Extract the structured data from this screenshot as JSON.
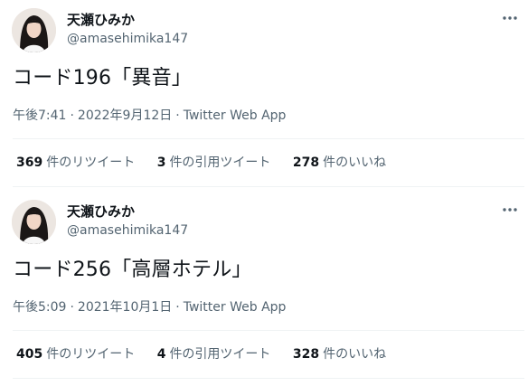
{
  "tweets": [
    {
      "display_name": "天瀬ひみか",
      "handle": "@amasehimika147",
      "text": "コード196「異音」",
      "time": "午後7:41",
      "date": "2022年9月12日",
      "source": "Twitter Web App",
      "separator": "·",
      "retweets_count": "369",
      "retweets_label": "件のリツイート",
      "quotes_count": "3",
      "quotes_label": "件の引用ツイート",
      "likes_count": "278",
      "likes_label": "件のいいね",
      "avatar_icon": "profile-photo",
      "more_icon": "more-horizontal-icon"
    },
    {
      "display_name": "天瀬ひみか",
      "handle": "@amasehimika147",
      "text": "コード256「高層ホテル」",
      "time": "午後5:09",
      "date": "2021年10月1日",
      "source": "Twitter Web App",
      "separator": "·",
      "retweets_count": "405",
      "retweets_label": "件のリツイート",
      "quotes_count": "4",
      "quotes_label": "件の引用ツイート",
      "likes_count": "328",
      "likes_label": "件のいいね",
      "avatar_icon": "profile-photo",
      "more_icon": "more-horizontal-icon"
    }
  ],
  "colors": {
    "text_primary": "#0f1419",
    "text_secondary": "#536471",
    "divider": "#eff3f4",
    "background": "#ffffff"
  }
}
